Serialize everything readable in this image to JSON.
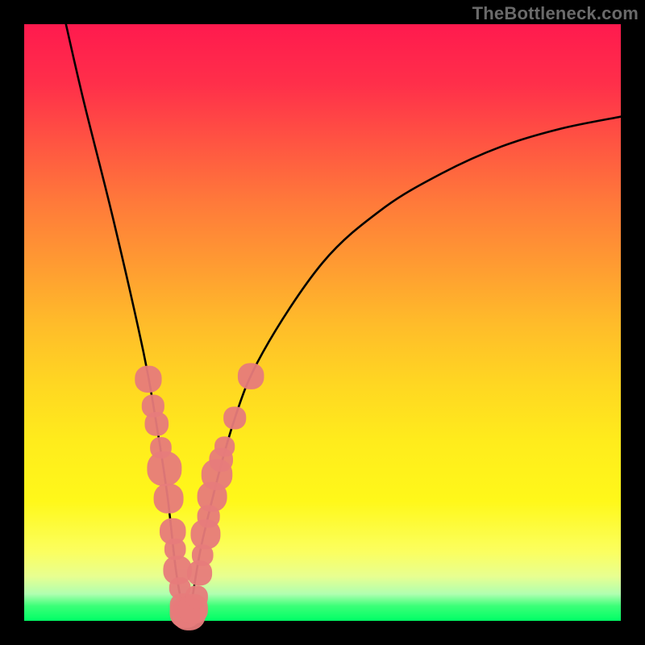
{
  "watermark": "TheBottleneck.com",
  "chart_data": {
    "type": "line",
    "title": "",
    "xlabel": "",
    "ylabel": "",
    "xlim": [
      0,
      100
    ],
    "ylim": [
      0,
      100
    ],
    "background_gradient": {
      "orientation": "vertical",
      "stops": [
        {
          "pos": 0.0,
          "color": "#ff1a4e"
        },
        {
          "pos": 0.5,
          "color": "#ffbb2a"
        },
        {
          "pos": 0.8,
          "color": "#fff81a"
        },
        {
          "pos": 1.0,
          "color": "#00ff66"
        }
      ]
    },
    "series": [
      {
        "name": "bottleneck-curve",
        "color": "#000000",
        "x": [
          7,
          10,
          15,
          20,
          22,
          24,
          25.5,
          27,
          28,
          30,
          35,
          40,
          50,
          60,
          70,
          80,
          90,
          100
        ],
        "y": [
          100,
          87,
          67,
          45,
          34,
          21,
          8,
          1,
          3,
          14,
          33,
          45,
          60,
          69,
          75,
          79.5,
          82.5,
          84.5
        ]
      }
    ],
    "markers": [
      {
        "name": "left-branch-points",
        "color": "#e77b7b",
        "shape": "rounded",
        "points": [
          {
            "x": 20.8,
            "y": 40.5,
            "size": 4.5
          },
          {
            "x": 21.6,
            "y": 36.0,
            "size": 3.8
          },
          {
            "x": 22.2,
            "y": 33.0,
            "size": 4.0
          },
          {
            "x": 22.9,
            "y": 29.0,
            "size": 3.6
          },
          {
            "x": 23.5,
            "y": 25.5,
            "size": 5.8
          },
          {
            "x": 24.2,
            "y": 20.5,
            "size": 5.0
          },
          {
            "x": 24.9,
            "y": 15.0,
            "size": 4.4
          },
          {
            "x": 25.3,
            "y": 12.0,
            "size": 3.6
          },
          {
            "x": 25.7,
            "y": 8.5,
            "size": 4.8
          },
          {
            "x": 26.1,
            "y": 5.5,
            "size": 3.6
          }
        ]
      },
      {
        "name": "bottom-points",
        "color": "#e77b7b",
        "shape": "rounded",
        "points": [
          {
            "x": 26.5,
            "y": 2.5,
            "size": 4.2
          },
          {
            "x": 27.0,
            "y": 1.4,
            "size": 5.2
          },
          {
            "x": 27.6,
            "y": 1.2,
            "size": 5.6
          },
          {
            "x": 28.3,
            "y": 2.0,
            "size": 5.0
          },
          {
            "x": 28.9,
            "y": 4.0,
            "size": 3.8
          }
        ]
      },
      {
        "name": "right-branch-points",
        "color": "#e77b7b",
        "shape": "rounded",
        "points": [
          {
            "x": 29.4,
            "y": 8.0,
            "size": 4.2
          },
          {
            "x": 29.9,
            "y": 11.0,
            "size": 3.6
          },
          {
            "x": 30.4,
            "y": 14.5,
            "size": 5.0
          },
          {
            "x": 30.9,
            "y": 17.5,
            "size": 3.8
          },
          {
            "x": 31.5,
            "y": 20.8,
            "size": 5.0
          },
          {
            "x": 32.3,
            "y": 24.5,
            "size": 5.2
          },
          {
            "x": 33.0,
            "y": 27.0,
            "size": 4.0
          },
          {
            "x": 33.6,
            "y": 29.2,
            "size": 3.4
          },
          {
            "x": 35.3,
            "y": 34.0,
            "size": 3.8
          },
          {
            "x": 38.0,
            "y": 41.0,
            "size": 4.4
          }
        ]
      }
    ]
  }
}
